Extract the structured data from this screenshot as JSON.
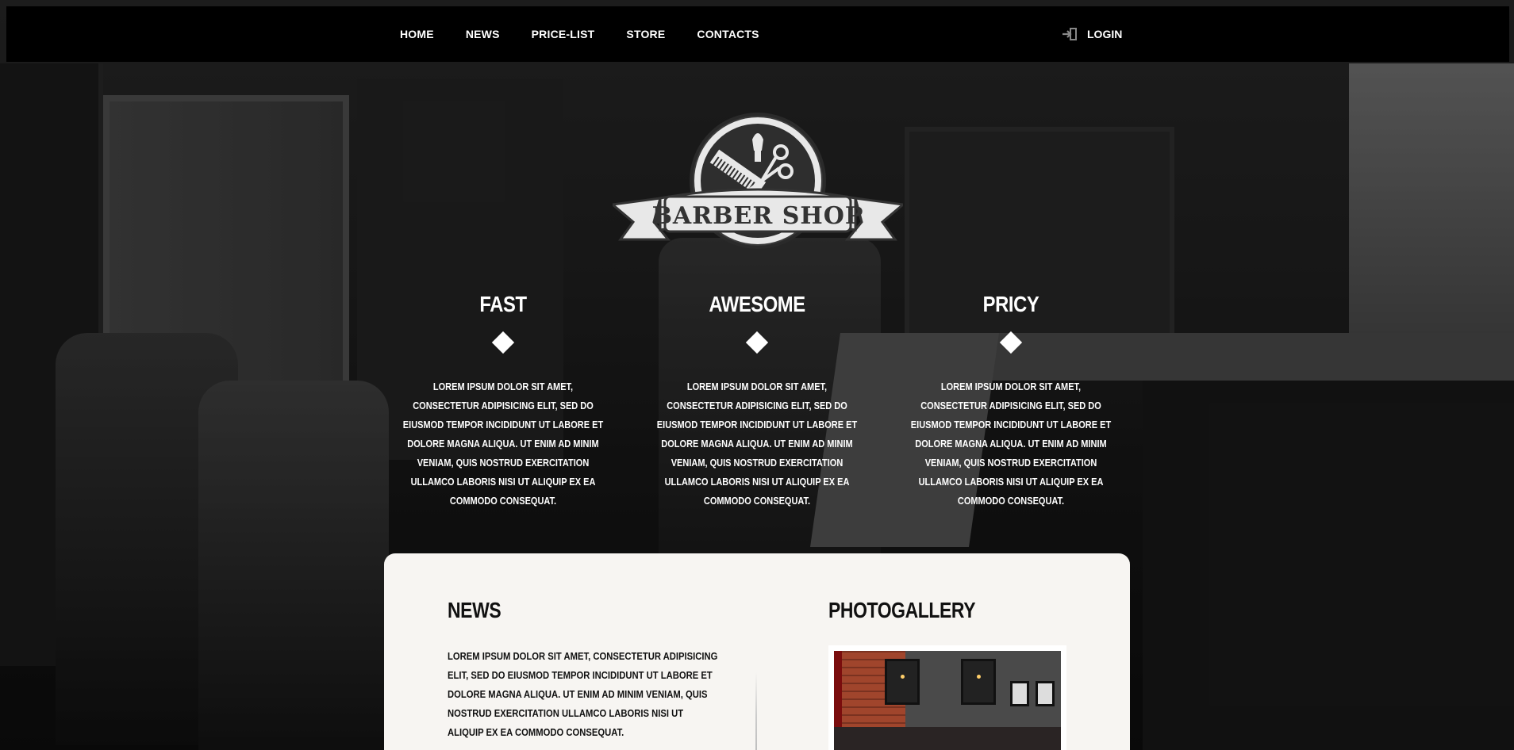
{
  "nav": {
    "links": [
      "HOME",
      "NEWS",
      "PRICE-LIST",
      "STORE",
      "CONTACTS"
    ],
    "login_label": "LOGIN",
    "login_icon": "sign-in-icon"
  },
  "logo": {
    "text": "BARBER SHOP",
    "icons": [
      "comb-icon",
      "shaving-brush-icon",
      "scissors-icon"
    ]
  },
  "features": [
    {
      "title": "FAST",
      "text": "LOREM IPSUM DOLOR SIT AMET, CONSECTETUR ADIPISICING ELIT, SED DO EIUSMOD TEMPOR INCIDIDUNT UT LABORE ET DOLORE MAGNA ALIQUA. UT ENIM AD MINIM VENIAM, QUIS NOSTRUD EXERCITATION ULLAMCO LABORIS NISI UT ALIQUIP EX EA COMMODO CONSEQUAT."
    },
    {
      "title": "AWESOME",
      "text": "LOREM IPSUM DOLOR SIT AMET, CONSECTETUR ADIPISICING ELIT, SED DO EIUSMOD TEMPOR INCIDIDUNT UT LABORE ET DOLORE MAGNA ALIQUA. UT ENIM AD MINIM VENIAM, QUIS NOSTRUD EXERCITATION ULLAMCO LABORIS NISI UT ALIQUIP EX EA COMMODO CONSEQUAT."
    },
    {
      "title": "PRICY",
      "text": "LOREM IPSUM DOLOR SIT AMET, CONSECTETUR ADIPISICING ELIT, SED DO EIUSMOD TEMPOR INCIDIDUNT UT LABORE ET DOLORE MAGNA ALIQUA. UT ENIM AD MINIM VENIAM, QUIS NOSTRUD EXERCITATION ULLAMCO LABORIS NISI UT ALIQUIP EX EA COMMODO CONSEQUAT."
    }
  ],
  "news": {
    "title": "NEWS",
    "text": "LOREM IPSUM DOLOR SIT AMET, CONSECTETUR ADIPISICING ELIT, SED DO EIUSMOD TEMPOR INCIDIDUNT UT LABORE ET DOLORE MAGNA ALIQUA. UT ENIM AD MINIM VENIAM, QUIS NOSTRUD EXERCITATION ULLAMCO LABORIS NISI UT ALIQUIP EX EA COMMODO CONSEQUAT."
  },
  "gallery": {
    "title": "PHOTOGALLERY"
  },
  "colors": {
    "nav_bg": "#000000",
    "card_bg": "#f7f5f2",
    "text_light": "#ffffff",
    "text_dark": "#111111"
  }
}
